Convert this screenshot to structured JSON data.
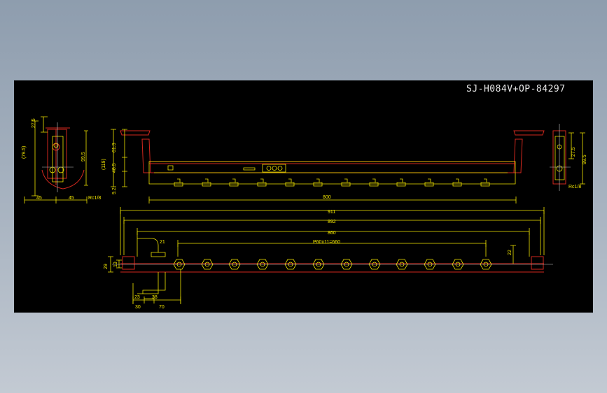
{
  "drawing_title": "SJ-H084V+OP-84297",
  "colors": {
    "background": "#000000",
    "dimension": "#f2e600",
    "outline": "#d2281e",
    "centerline": "#c8c8c8",
    "page": "#a3afbd"
  },
  "left_view": {
    "dims": [
      "27.5",
      "(79.5)",
      "99.5",
      "45",
      "45",
      "Rc1/8"
    ]
  },
  "front_view": {
    "dims": [
      "61.3",
      "(119)",
      "48.5",
      "9.2",
      "800"
    ]
  },
  "right_view": {
    "dims": [
      "27.5",
      "99.5",
      "Rc1/8"
    ]
  },
  "top_view": {
    "dims": [
      "911",
      "892",
      "860",
      "P60x11=660",
      "21",
      "22",
      "29",
      "13",
      "23",
      "38",
      "30",
      "70"
    ],
    "nozzle_count": 12
  }
}
